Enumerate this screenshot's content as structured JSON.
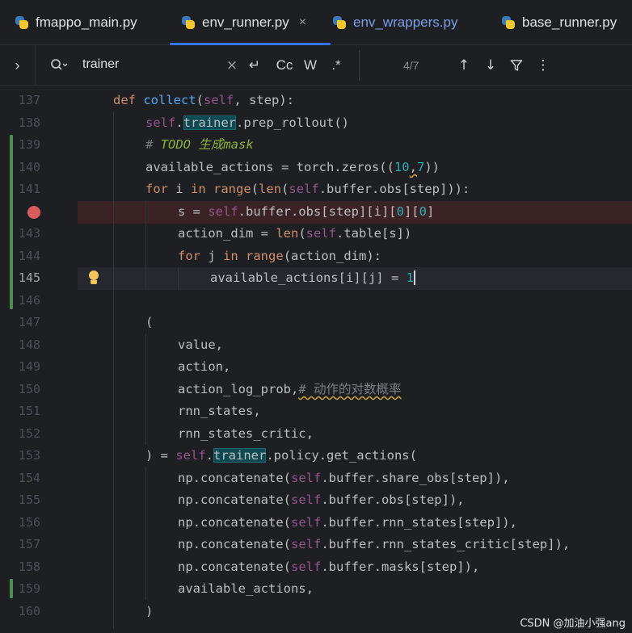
{
  "tabs": [
    {
      "label": "fmappo_main.py"
    },
    {
      "label": "env_runner.py",
      "close": "×"
    },
    {
      "label": "env_wrappers.py"
    },
    {
      "label": "base_runner.py"
    }
  ],
  "search": {
    "expand": "›",
    "search_icon": "⌕",
    "query": "trainer",
    "clear": "×",
    "regex_toggle_label": ".*",
    "case_label": "Cc",
    "word_label": "W",
    "newline_icon": "↵",
    "match_count": "4/7",
    "prev": "↑",
    "next": "↓",
    "filter": "⛉",
    "more": "⋮"
  },
  "editor": {
    "lines": [
      {
        "n": "137"
      },
      {
        "n": "138"
      },
      {
        "n": "139"
      },
      {
        "n": "140"
      },
      {
        "n": "141"
      },
      {
        "n": ""
      },
      {
        "n": "143"
      },
      {
        "n": "144"
      },
      {
        "n": "145"
      },
      {
        "n": "146"
      },
      {
        "n": "147"
      },
      {
        "n": "148"
      },
      {
        "n": "149"
      },
      {
        "n": "150"
      },
      {
        "n": "151"
      },
      {
        "n": "152"
      },
      {
        "n": "153"
      },
      {
        "n": "154"
      },
      {
        "n": "155"
      },
      {
        "n": "156"
      },
      {
        "n": "157"
      },
      {
        "n": "158"
      },
      {
        "n": "159"
      },
      {
        "n": "160"
      }
    ],
    "code": {
      "l137": {
        "kw": "def",
        "fn": "collect",
        "open": "(",
        "self": "self",
        "rest": ", step):"
      },
      "l138": {
        "self": "self",
        "dot": ".",
        "match": "trainer",
        "rest": ".prep_rollout()"
      },
      "l139": {
        "hash": "# ",
        "todo": "TODO 生成mask"
      },
      "l140": {
        "a": "available_actions = torch.zeros((",
        "n1": "10",
        "comma": ",",
        "n2": "7",
        "b": "))"
      },
      "l141": {
        "kw1": "for",
        "a": " i ",
        "kw2": "in",
        "sp": " ",
        "fn1": "range",
        "p1": "(",
        "fn2": "len",
        "p2": "(",
        "self": "self",
        "b": ".buffer.obs[step])):"
      },
      "l142": {
        "a": "s = ",
        "self": "self",
        "b": ".buffer.obs[step][i][",
        "n1": "0",
        "c": "][",
        "n2": "0",
        "d": "]"
      },
      "l143": {
        "a": "action_dim = ",
        "fn": "len",
        "p": "(",
        "self": "self",
        "b": ".table[s])"
      },
      "l144": {
        "kw1": "for",
        "a": " j ",
        "kw2": "in",
        "sp": " ",
        "fn": "range",
        "b": "(action_dim):"
      },
      "l145": {
        "a": "available_actions[i][j] = ",
        "n": "1"
      },
      "l147": {
        "a": "("
      },
      "l148": {
        "a": "value,"
      },
      "l149": {
        "a": "action,"
      },
      "l150": {
        "a": "action_log_prob,",
        "cmt": "# 动作的对数概率"
      },
      "l151": {
        "a": "rnn_states,"
      },
      "l152": {
        "a": "rnn_states_critic,"
      },
      "l153": {
        "a": ") = ",
        "self": "self",
        "dot": ".",
        "match": "trainer",
        "b": ".policy.get_actions("
      },
      "l154": {
        "a": "np.concatenate(",
        "self": "self",
        "b": ".buffer.share_obs[step]),"
      },
      "l155": {
        "a": "np.concatenate(",
        "self": "self",
        "b": ".buffer.obs[step]),"
      },
      "l156": {
        "a": "np.concatenate(",
        "self": "self",
        "b": ".buffer.rnn_states[step]),"
      },
      "l157": {
        "a": "np.concatenate(",
        "self": "self",
        "b": ".buffer.rnn_states_critic[step]),"
      },
      "l158": {
        "a": "np.concatenate(",
        "self": "self",
        "b": ".buffer.masks[step]),"
      },
      "l159": {
        "a": "available_actions,"
      },
      "l160": {
        "a": ")"
      }
    }
  },
  "watermark": "CSDN @加油小强ang",
  "colors": {
    "background": "#1e1f22",
    "keyword": "#cf8e6d",
    "self": "#94558d",
    "function": "#56a8f5",
    "number": "#2aacb8",
    "search_highlight": "#0f4a52",
    "breakpoint": "#db5c5c",
    "tab_underline": "#3574f0"
  },
  "icons": {
    "tab_file_icon": "python-file-icon",
    "breakpoint": "breakpoint-icon",
    "intention": "lightbulb-icon"
  }
}
